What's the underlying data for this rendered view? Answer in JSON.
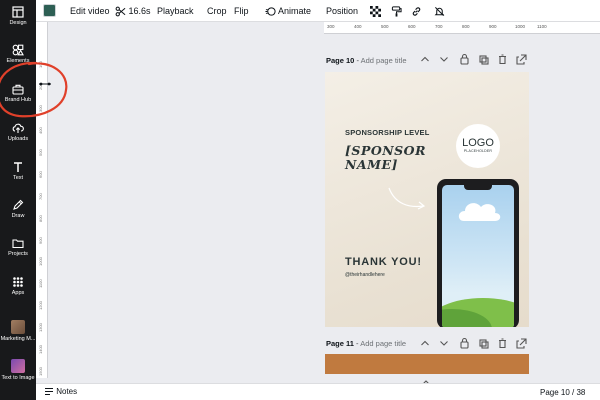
{
  "sidebar": {
    "items": [
      {
        "label": "Design",
        "icon": "layout-icon"
      },
      {
        "label": "Elements",
        "icon": "shapes-icon"
      },
      {
        "label": "Brand Hub",
        "icon": "briefcase-icon"
      },
      {
        "label": "Uploads",
        "icon": "cloud-upload-icon"
      },
      {
        "label": "Text",
        "icon": "text-t-icon"
      },
      {
        "label": "Draw",
        "icon": "pen-icon"
      },
      {
        "label": "Projects",
        "icon": "folder-icon"
      },
      {
        "label": "Apps",
        "icon": "apps-grid-icon"
      },
      {
        "label": "Marketing M...",
        "icon": "app-thumbnail"
      },
      {
        "label": "Text to Image",
        "icon": "app-thumbnail"
      }
    ]
  },
  "toolbar": {
    "color_swatch": "#2e5f54",
    "edit_video": "Edit video",
    "duration": "16.6s",
    "playback": "Playback",
    "crop": "Crop",
    "flip": "Flip",
    "animate": "Animate",
    "position": "Position"
  },
  "rulers": {
    "horizontal": [
      "300",
      "400",
      "500",
      "600",
      "700",
      "800",
      "900",
      "1000",
      "1100"
    ],
    "vertical": [
      "100",
      "200",
      "300",
      "400",
      "500",
      "600",
      "700",
      "800",
      "900",
      "1000",
      "1100",
      "1200",
      "1300",
      "1400",
      "1500",
      "1600"
    ]
  },
  "pages": [
    {
      "number": "Page 10",
      "title_placeholder": "Add page title"
    },
    {
      "number": "Page 11",
      "title_placeholder": "Add page title"
    }
  ],
  "design": {
    "sponsorship_level": "SPONSORSHIP LEVEL",
    "sponsor_name_line1": "[SPONSOR",
    "sponsor_name_line2": "NAME]",
    "logo_text": "LOGO",
    "logo_sub": "PLACEHOLDER",
    "thank_you": "THANK YOU!",
    "handle": "@theirhandlehere"
  },
  "bottom": {
    "notes": "Notes",
    "page_indicator": "Page 10 / 38"
  },
  "colors": {
    "sidebar_bg": "#18191b",
    "canvas_bg": "#ebecf0",
    "annotation_red": "#e0402a",
    "design_text_dark": "#2a3536",
    "page11_fill": "#c07a3f"
  }
}
